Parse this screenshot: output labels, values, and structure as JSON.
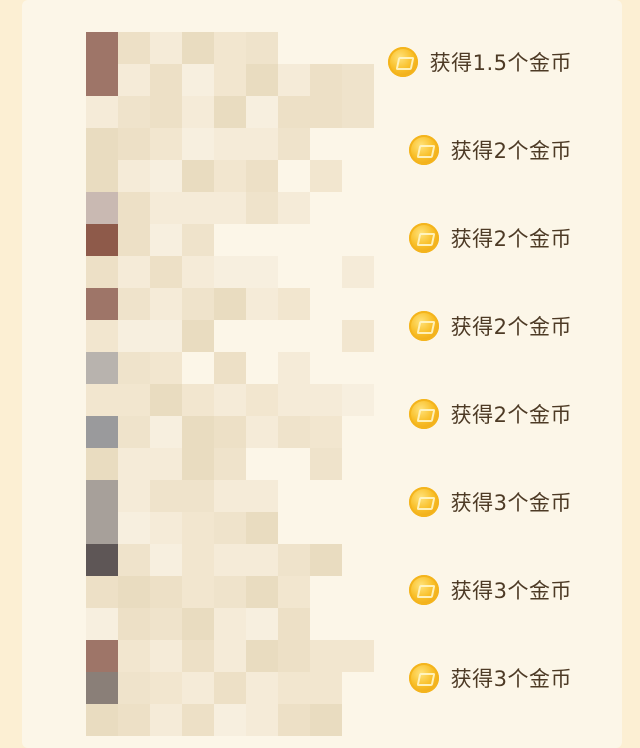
{
  "rewards": [
    {
      "label": "获得1.5个金币",
      "icon": "gold-coin-icon"
    },
    {
      "label": "获得2个金币",
      "icon": "gold-coin-icon"
    },
    {
      "label": "获得2个金币",
      "icon": "gold-coin-icon"
    },
    {
      "label": "获得2个金币",
      "icon": "gold-coin-icon"
    },
    {
      "label": "获得2个金币",
      "icon": "gold-coin-icon"
    },
    {
      "label": "获得3个金币",
      "icon": "gold-coin-icon"
    },
    {
      "label": "获得3个金币",
      "icon": "gold-coin-icon"
    },
    {
      "label": "获得3个金币",
      "icon": "gold-coin-icon"
    }
  ],
  "colors": {
    "outer_background": "#FCEFD3",
    "panel_background": "#FCF6E8",
    "reward_text": "#4D3A25",
    "coin_gold": "#F9C02A"
  }
}
